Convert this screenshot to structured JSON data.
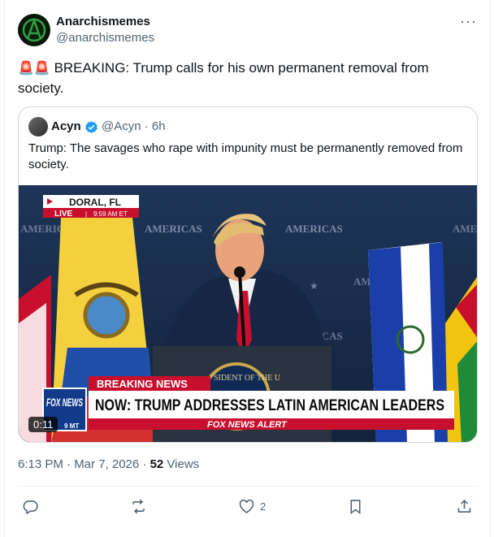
{
  "author": {
    "name": "Anarchismemes",
    "handle": "@anarchismemes"
  },
  "tweet": {
    "emoji": "🚨🚨",
    "text": " BREAKING:  Trump calls for his own permanent removal from society."
  },
  "quote": {
    "name": "Acyn",
    "handle": "@Acyn · 6h",
    "text": "Trump: The savages who rape with impunity must be permanently removed from society."
  },
  "video": {
    "duration": "0:11",
    "location": "DORAL, FL",
    "live_label": "LIVE",
    "live_time": "9:59 AM ET",
    "breaking_label": "BREAKING NEWS",
    "headline": "NOW: TRUMP ADDRESSES LATIN AMERICAN LEADERS",
    "network_logo": "FOX NEWS",
    "logo_sub": "9 MT",
    "alert": "FOX NEWS ALERT",
    "backdrop_text": "AMERICAS"
  },
  "meta": {
    "time": "6:13 PM · Mar 7, 2026 · ",
    "views_count": "52",
    "views_label": " Views"
  },
  "actions": {
    "like_count": "2"
  },
  "colors": {
    "verified": "#1d9bf0",
    "text_secondary": "#536471",
    "border": "#cfd9de"
  }
}
